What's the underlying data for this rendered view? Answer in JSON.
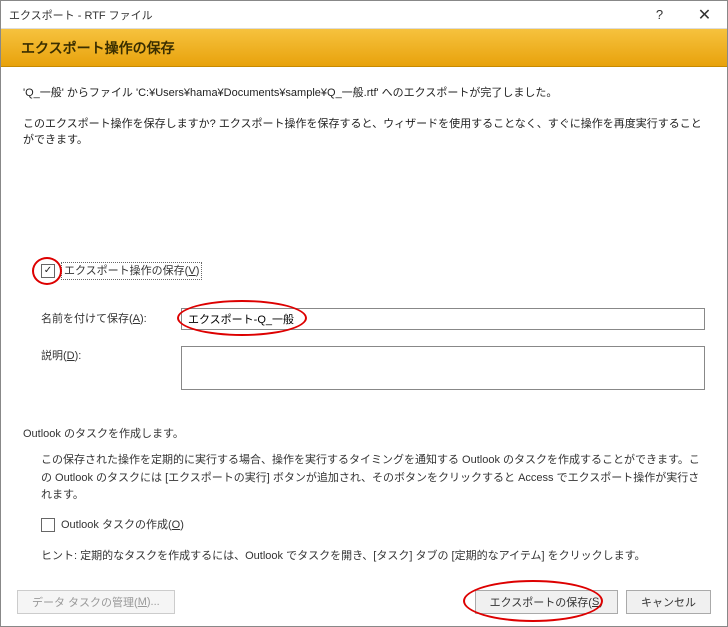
{
  "titlebar": {
    "text": "エクスポート - RTF ファイル"
  },
  "header": {
    "title": "エクスポート操作の保存"
  },
  "messages": {
    "line1": "'Q_一般' からファイル 'C:¥Users¥hama¥Documents¥sample¥Q_一般.rtf' へのエクスポートが完了しました。",
    "line2": "このエクスポート操作を保存しますか? エクスポート操作を保存すると、ウィザードを使用することなく、すぐに操作を再度実行することができます。"
  },
  "saveOp": {
    "checkboxLabelPre": "エクスポート操作の保存(",
    "checkboxAccel": "V",
    "checkboxLabelPost": ")",
    "checked": true
  },
  "nameRow": {
    "labelPre": "名前を付けて保存(",
    "labelAccel": "A",
    "labelPost": "):",
    "value": "エクスポート-Q_一般"
  },
  "descRow": {
    "labelPre": "説明(",
    "labelAccel": "D",
    "labelPost": "):",
    "value": ""
  },
  "outlook": {
    "heading": "Outlook のタスクを作成します。",
    "body": "この保存された操作を定期的に実行する場合、操作を実行するタイミングを通知する Outlook のタスクを作成することができます。この Outlook のタスクには [エクスポートの実行] ボタンが追加され、そのボタンをクリックすると Access でエクスポート操作が実行されます。",
    "checkboxLabelPre": "Outlook タスクの作成(",
    "checkboxAccel": "O",
    "checkboxLabelPost": ")",
    "checked": false,
    "hint": "ヒント: 定期的なタスクを作成するには、Outlook でタスクを開き、[タスク] タブの [定期的なアイテム] をクリックします。"
  },
  "footer": {
    "manageLabelPre": "データ タスクの管理(",
    "manageAccel": "M",
    "manageLabelPost": ")...",
    "saveLabelPre": "エクスポートの保存(",
    "saveAccel": "S",
    "saveLabelPost": ")",
    "cancelLabel": "キャンセル"
  }
}
